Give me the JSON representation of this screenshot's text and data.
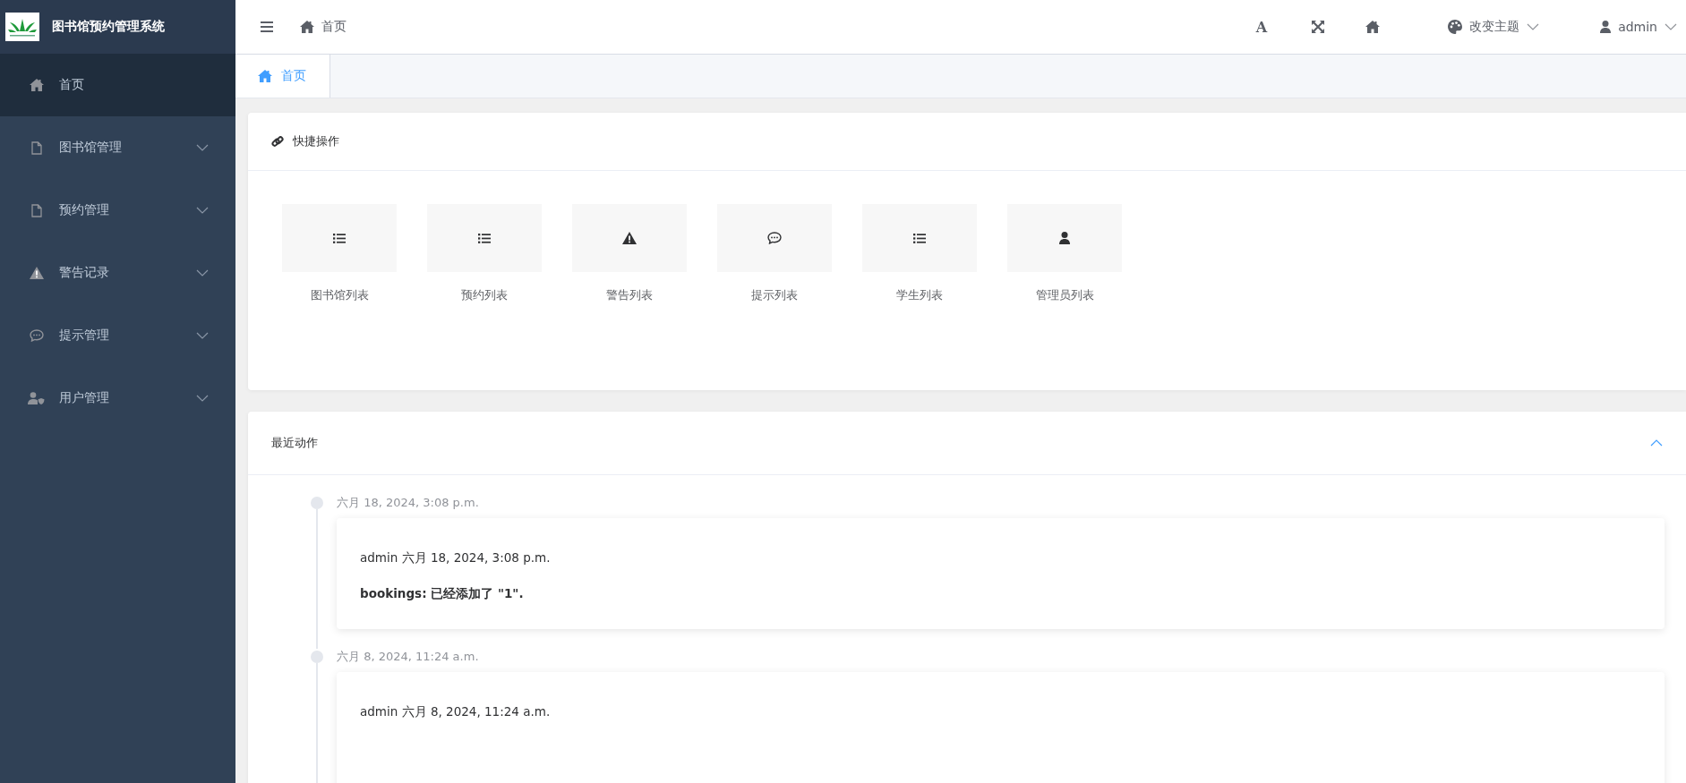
{
  "sidebar": {
    "title": "图书馆预约管理系统",
    "items": [
      {
        "label": "首页",
        "kind": "link",
        "selected": true
      },
      {
        "label": "图书馆管理",
        "kind": "group",
        "selected": false,
        "expanded": false
      },
      {
        "label": "预约管理",
        "kind": "group",
        "selected": false,
        "expanded": false
      },
      {
        "label": "警告记录",
        "kind": "group",
        "selected": false,
        "expanded": false
      },
      {
        "label": "提示管理",
        "kind": "group",
        "selected": false,
        "expanded": false
      },
      {
        "label": "用户管理",
        "kind": "group",
        "selected": false,
        "expanded": false
      }
    ]
  },
  "header": {
    "breadcrumb": "首页",
    "font_button": "A",
    "theme_label": "改变主题",
    "user": "admin"
  },
  "tabs": [
    {
      "label": "首页",
      "selected": true
    }
  ],
  "quick_actions": {
    "title": "快捷操作",
    "items": [
      {
        "label": "图书馆列表"
      },
      {
        "label": "预约列表"
      },
      {
        "label": "警告列表"
      },
      {
        "label": "提示列表"
      },
      {
        "label": "学生列表"
      },
      {
        "label": "管理员列表"
      }
    ]
  },
  "recent_actions": {
    "title": "最近动作",
    "expanded": true,
    "entries": [
      {
        "date": "六月 18, 2024, 3:08 p.m.",
        "byline": "admin 六月 18, 2024, 3:08 p.m.",
        "message": "bookings: 已经添加了 \"1\"."
      },
      {
        "date": "六月 8, 2024, 11:24 a.m.",
        "byline": "admin 六月 8, 2024, 11:24 a.m."
      }
    ]
  }
}
